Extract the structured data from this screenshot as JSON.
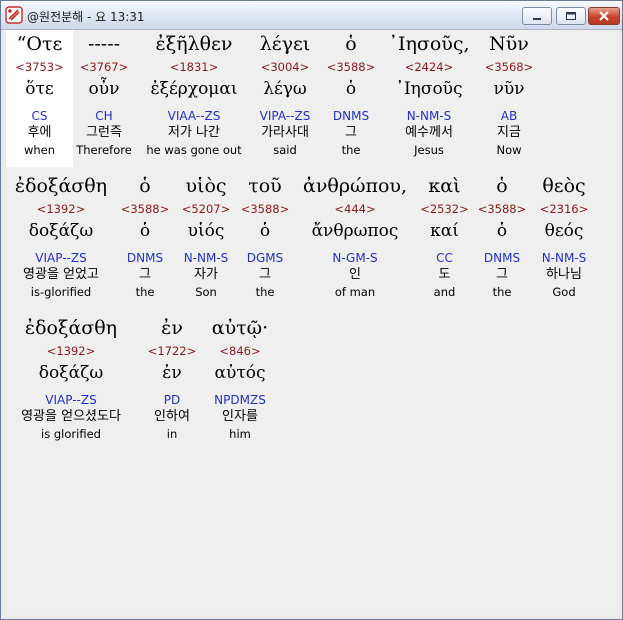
{
  "window": {
    "title": "@원전분해 - 요 13:31"
  },
  "words": [
    {
      "greek": "“Οτε",
      "strong": "<3753>",
      "lemma": "ὅτε",
      "parse": "CS",
      "korean": "후에",
      "english": "when"
    },
    {
      "greek": "-----",
      "strong": "<3767>",
      "lemma": "οὖν",
      "parse": "CH",
      "korean": "그런즉",
      "english": "Therefore"
    },
    {
      "greek": "ἐξῆλθεν",
      "strong": "<1831>",
      "lemma": "ἐξέρχομαι",
      "parse": "VIAA--ZS",
      "korean": "저가 나간",
      "english": "he was gone out"
    },
    {
      "greek": "λέγει",
      "strong": "<3004>",
      "lemma": "λέγω",
      "parse": "VIPA--ZS",
      "korean": "가라사대",
      "english": "said"
    },
    {
      "greek": "ὁ",
      "strong": "<3588>",
      "lemma": "ὁ",
      "parse": "DNMS",
      "korean": "그",
      "english": "the"
    },
    {
      "greek": "᾿Ιησοῦς,",
      "strong": "<2424>",
      "lemma": "᾿Ιησοῦς",
      "parse": "N-NM-S",
      "korean": "예수께서",
      "english": "Jesus"
    },
    {
      "greek": "Νῦν",
      "strong": "<3568>",
      "lemma": "νῦν",
      "parse": "AB",
      "korean": "지금",
      "english": "Now"
    },
    {
      "greek": "ἐδοξάσθη",
      "strong": "<1392>",
      "lemma": "δοξάζω",
      "parse": "VIAP--ZS",
      "korean": "영광을 얻었고",
      "english": "is-glorified"
    },
    {
      "greek": "ὁ",
      "strong": "<3588>",
      "lemma": "ὁ",
      "parse": "DNMS",
      "korean": "그",
      "english": "the"
    },
    {
      "greek": "υἱὸς",
      "strong": "<5207>",
      "lemma": "υἱός",
      "parse": "N-NM-S",
      "korean": "자가",
      "english": "Son"
    },
    {
      "greek": "τοῦ",
      "strong": "<3588>",
      "lemma": "ὁ",
      "parse": "DGMS",
      "korean": "그",
      "english": "the"
    },
    {
      "greek": "ἀνθρώπου,",
      "strong": "<444>",
      "lemma": "ἄνθρωπος",
      "parse": "N-GM-S",
      "korean": "인",
      "english": "of man"
    },
    {
      "greek": "καὶ",
      "strong": "<2532>",
      "lemma": "καί",
      "parse": "CC",
      "korean": "도",
      "english": "and"
    },
    {
      "greek": "ὁ",
      "strong": "<3588>",
      "lemma": "ὁ",
      "parse": "DNMS",
      "korean": "그",
      "english": "the"
    },
    {
      "greek": "θεὸς",
      "strong": "<2316>",
      "lemma": "θεός",
      "parse": "N-NM-S",
      "korean": "하나님",
      "english": "God"
    },
    {
      "greek": "ἐδοξάσθη",
      "strong": "<1392>",
      "lemma": "δοξάζω",
      "parse": "VIAP--ZS",
      "korean": "영광을 얻으셨도다",
      "english": "is glorified"
    },
    {
      "greek": "ἐν",
      "strong": "<1722>",
      "lemma": "ἐν",
      "parse": "PD",
      "korean": "인하여",
      "english": "in"
    },
    {
      "greek": "αὐτῷ·",
      "strong": "<846>",
      "lemma": "αὐτός",
      "parse": "NPDMZS",
      "korean": "인자를",
      "english": "him"
    }
  ]
}
